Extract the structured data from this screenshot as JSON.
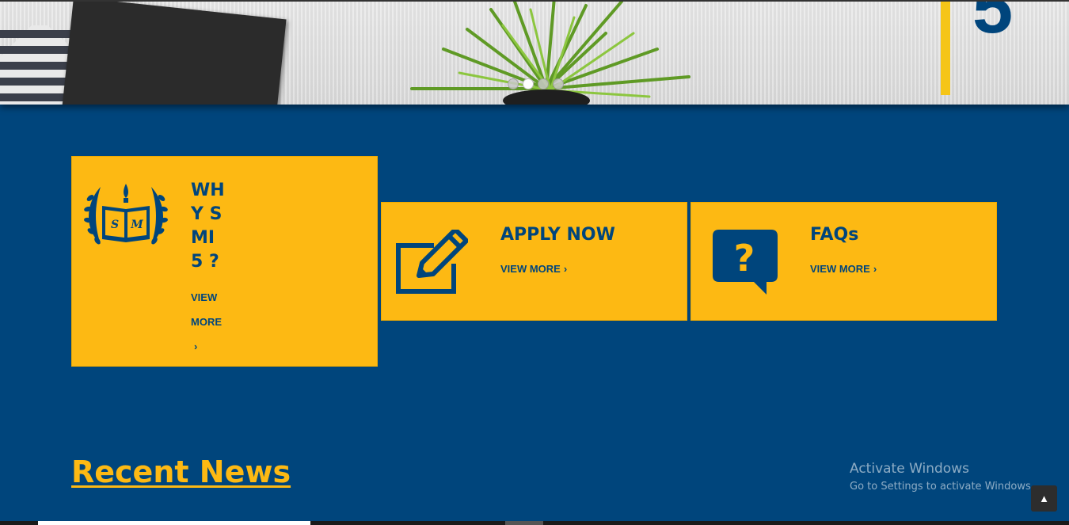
{
  "hero": {
    "digit": "5",
    "slides": [
      {
        "active": false
      },
      {
        "active": true
      },
      {
        "active": false
      },
      {
        "active": false
      }
    ]
  },
  "cards": [
    {
      "title": "WHY SMI 5 ?",
      "more": "VIEW MORE",
      "icon": "school-emblem-icon"
    },
    {
      "title": "APPLY NOW",
      "more": "VIEW MORE",
      "icon": "edit-icon"
    },
    {
      "title": "FAQs",
      "more": "VIEW MORE",
      "icon": "question-bubble-icon"
    }
  ],
  "news": {
    "heading": "Recent News"
  },
  "windows": {
    "title": "Activate Windows",
    "subtitle": "Go to Settings to activate Windows."
  },
  "scroll_top": {
    "icon": "chevron-up-icon"
  },
  "colors": {
    "brand_blue": "#00457c",
    "brand_yellow": "#fdb913"
  }
}
